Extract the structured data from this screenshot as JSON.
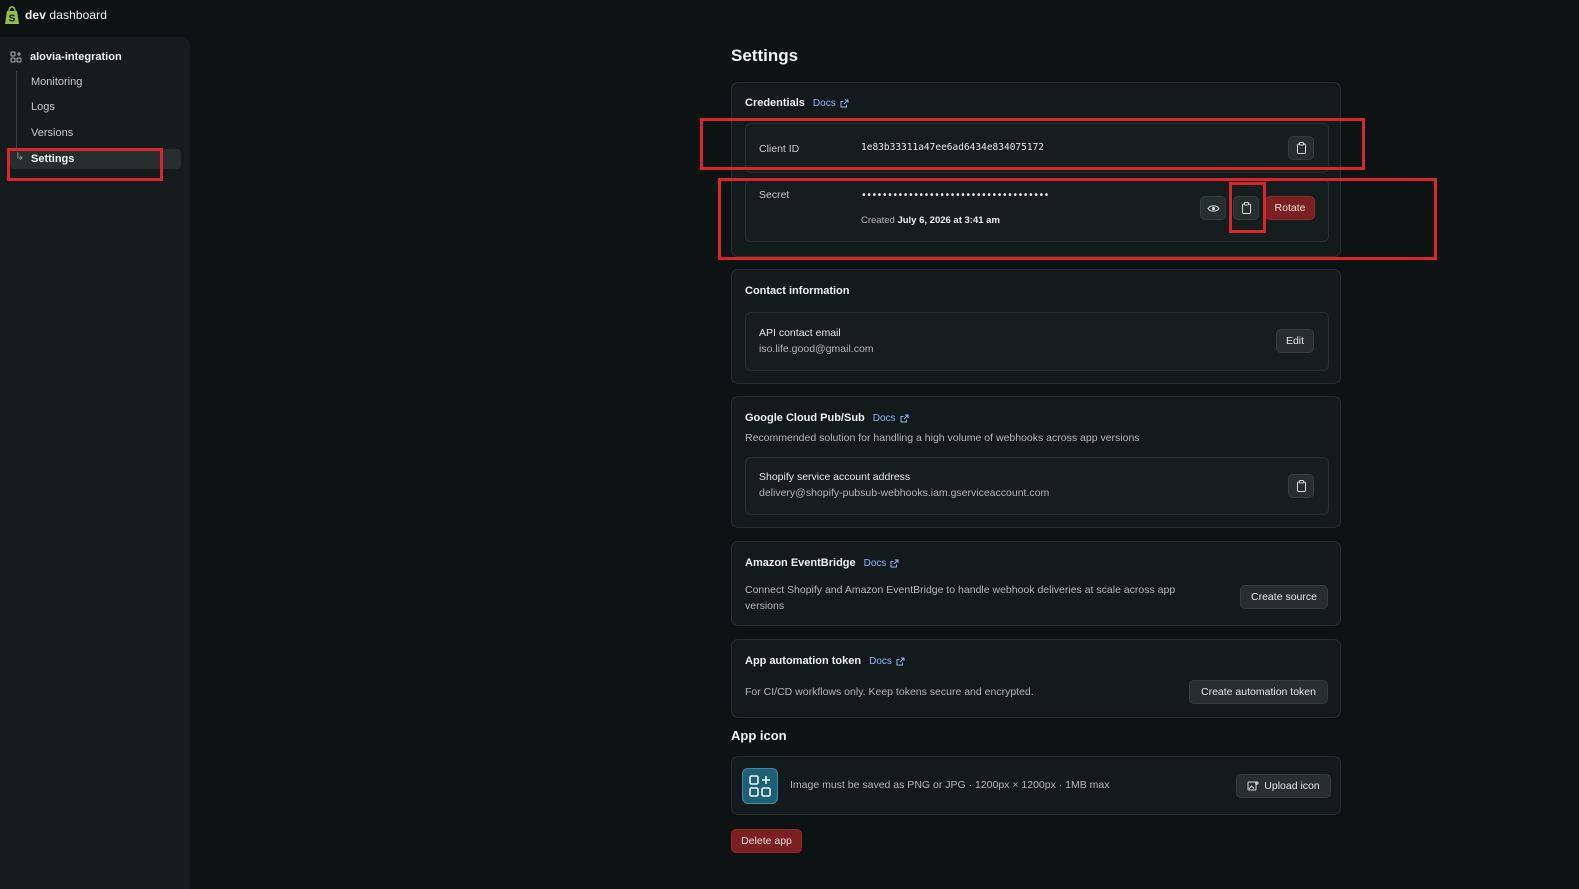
{
  "topbar": {
    "brand_bold": "dev",
    "brand_rest": " dashboard"
  },
  "sidebar": {
    "app_name": "alovia-integration",
    "items": [
      {
        "label": "Monitoring"
      },
      {
        "label": "Logs"
      },
      {
        "label": "Versions"
      },
      {
        "label": "Settings",
        "active": true
      }
    ]
  },
  "page": {
    "title": "Settings"
  },
  "credentials": {
    "title": "Credentials",
    "docs_label": "Docs",
    "client_id_label": "Client ID",
    "client_id_value": "1e83b33311a47ee6ad6434e834075172",
    "secret_label": "Secret",
    "secret_value": "••••••••••••••••••••••••••••••••••••",
    "created_prefix": "Created",
    "created_date": "July 6, 2026 at 3:41 am",
    "rotate_label": "Rotate"
  },
  "contact": {
    "title": "Contact information",
    "email_label": "API contact email",
    "email_value": "iso.life.good@gmail.com",
    "edit_label": "Edit"
  },
  "pubsub": {
    "title": "Google Cloud Pub/Sub",
    "docs_label": "Docs",
    "description": "Recommended solution for handling a high volume of webhooks across app versions",
    "account_label": "Shopify service account address",
    "account_value": "delivery@shopify-pubsub-webhooks.iam.gserviceaccount.com"
  },
  "eventbridge": {
    "title": "Amazon EventBridge",
    "docs_label": "Docs",
    "description": "Connect Shopify and Amazon EventBridge to handle webhook deliveries at scale across app versions",
    "create_label": "Create source"
  },
  "automation": {
    "title": "App automation token",
    "docs_label": "Docs",
    "description": "For CI/CD workflows only. Keep tokens secure and encrypted.",
    "create_label": "Create automation token"
  },
  "app_icon": {
    "title": "App icon",
    "requirements": "Image must be saved as PNG or JPG · 1200px × 1200px · 1MB max",
    "upload_label": "Upload icon"
  },
  "delete_label": "Delete app",
  "colors": {
    "accent_link": "#8fb6ff",
    "danger": "#7a1f22",
    "highlight": "#d9262c",
    "shopify_green": "#95bf47"
  }
}
